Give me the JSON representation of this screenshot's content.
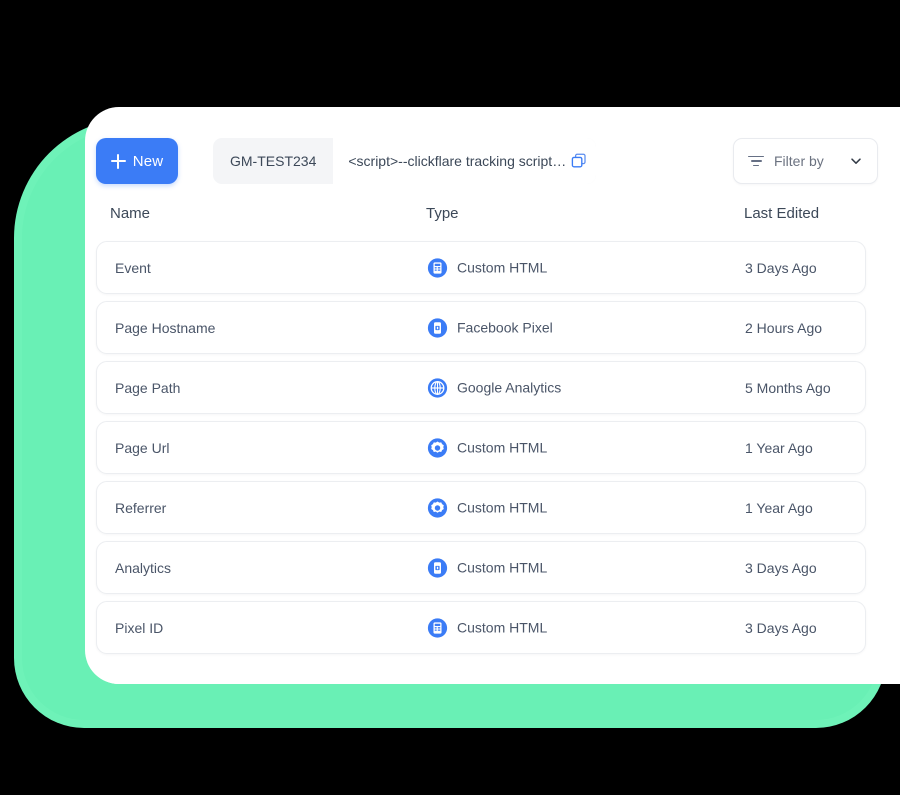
{
  "theme": {
    "accent_blue": "#3b7cf6",
    "icon_blue": "#3b7cf6",
    "mint_glow": "#6ef2b8",
    "card_bg": "#ffffff",
    "page_bg": "#000000",
    "text_primary": "#3c4858",
    "text_secondary": "#6b7280",
    "row_border": "#eceef1",
    "field_bg": "#f4f5f7"
  },
  "toolbar": {
    "new_button": {
      "label": "New",
      "icon": "plus-icon"
    },
    "script_field": {
      "tag_label": "GM-TEST234",
      "script_value": "<script>--clickflare tracking script ...",
      "copy_icon": "copy-icon"
    },
    "filter": {
      "label": "Filter by",
      "icon": "filter-lines-icon",
      "chevron_icon": "chevron-down-icon"
    }
  },
  "table": {
    "columns": [
      "Name",
      "Type",
      "Last Edited"
    ],
    "rows": [
      {
        "name": "Event",
        "type": "Custom HTML",
        "icon": "custom-html-icon",
        "last_edited": "3 Days Ago"
      },
      {
        "name": "Page Hostname",
        "type": "Facebook Pixel",
        "icon": "facebook-pixel-icon",
        "last_edited": "2 Hours Ago"
      },
      {
        "name": "Page Path",
        "type": "Google Analytics",
        "icon": "google-analytics-icon",
        "last_edited": "5 Months Ago"
      },
      {
        "name": "Page Url",
        "type": "Custom HTML",
        "icon": "gear-icon",
        "last_edited": "1 Year Ago"
      },
      {
        "name": "Referrer",
        "type": "Custom HTML",
        "icon": "gear-icon",
        "last_edited": "1 Year Ago"
      },
      {
        "name": "Analytics",
        "type": "Custom HTML",
        "icon": "facebook-pixel-icon",
        "last_edited": "3 Days Ago"
      },
      {
        "name": "Pixel ID",
        "type": "Custom HTML",
        "icon": "custom-html-icon",
        "last_edited": "3 Days Ago"
      }
    ]
  }
}
